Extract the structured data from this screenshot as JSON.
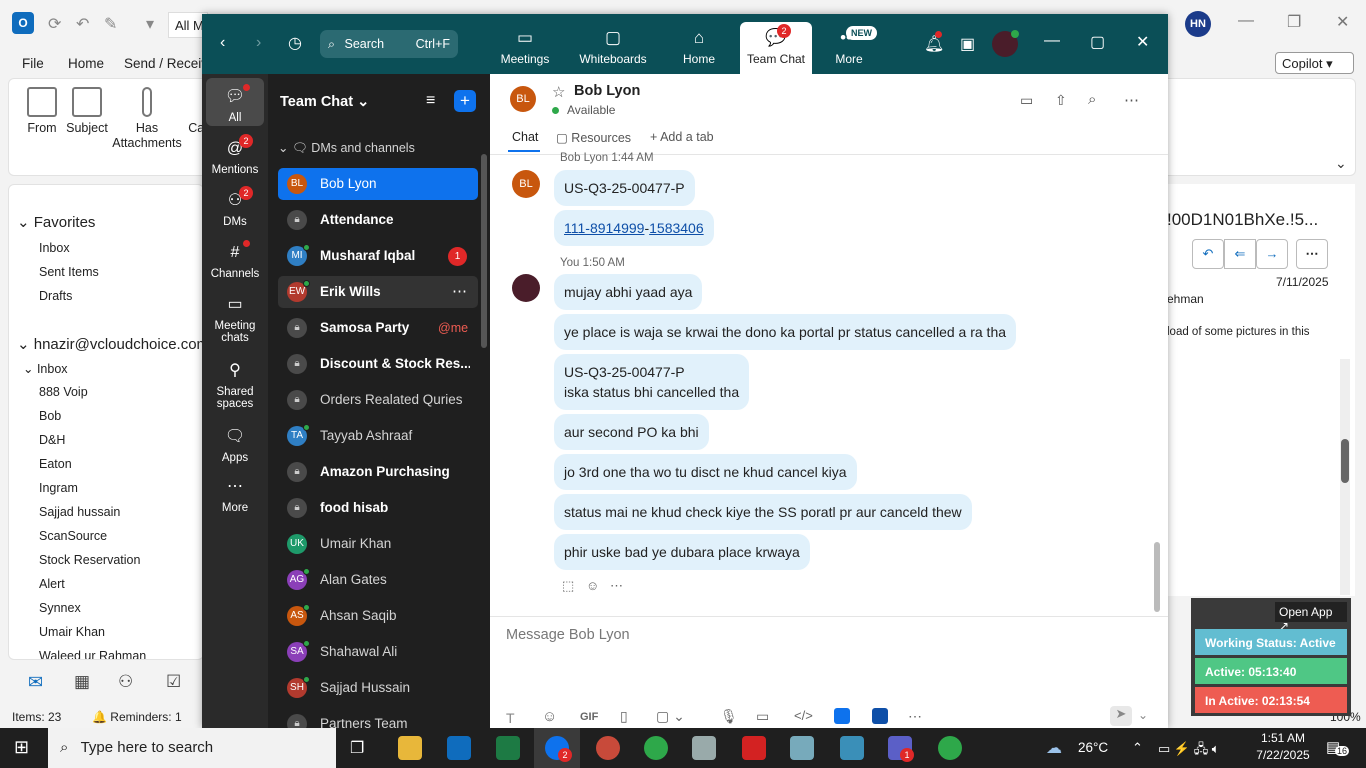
{
  "outlook": {
    "all_mail": "All M",
    "avatar": "HN",
    "menu": [
      "File",
      "Home",
      "Send / Receive"
    ],
    "ribbon": [
      "From",
      "Subject",
      "Has Attachments",
      "Cat"
    ],
    "copilot": "Copilot",
    "favorites_header": "Favorites",
    "favorites": [
      "Inbox",
      "Sent Items",
      "Drafts"
    ],
    "account": "hnazir@vcloudchoice.com",
    "inbox_header": "Inbox",
    "folders": [
      "888 Voip",
      "Bob",
      "D&H",
      "Eaton",
      "Ingram",
      "Sajjad hussain",
      "ScanSource",
      "Stock Reservation",
      "Alert",
      "Synnex",
      "Umair Khan",
      "Waleed ur Rahman"
    ],
    "status_items": "Items: 23",
    "status_reminders": "Reminders: 1",
    "zoom_level": "100%",
    "reading_subject": "!00D1N01BhXe.!5...",
    "reading_date": "7/11/2025",
    "reading_from": "ehman",
    "reading_snippet": "load of some pictures in this"
  },
  "zoom": {
    "search_label": "Search",
    "search_shortcut": "Ctrl+F",
    "tabs": [
      {
        "label": "Meetings"
      },
      {
        "label": "Whiteboards"
      },
      {
        "label": "Home"
      },
      {
        "label": "Team Chat",
        "badge": "2"
      },
      {
        "label": "More",
        "badge": "NEW"
      }
    ],
    "rail": [
      {
        "label": "All"
      },
      {
        "label": "Mentions",
        "badge": "2"
      },
      {
        "label": "DMs",
        "badge": "2"
      },
      {
        "label": "Channels"
      },
      {
        "label": "Meeting chats"
      },
      {
        "label": "Shared spaces"
      },
      {
        "label": "Apps"
      },
      {
        "label": "More"
      }
    ],
    "list_title": "Team Chat",
    "section": "DMs and channels",
    "conversations": [
      {
        "name": "Bob Lyon",
        "initials": "BL",
        "color": "#c8570e",
        "selected": true
      },
      {
        "name": "Attendance",
        "lock": true,
        "bold": true
      },
      {
        "name": "Musharaf Iqbal",
        "initials": "MI",
        "color": "#2f7fc4",
        "bold": true,
        "badge": "1",
        "online": true
      },
      {
        "name": "Erik Wills",
        "initials": "EW",
        "color": "#b23a2e",
        "bold": true,
        "online": true,
        "hover": true
      },
      {
        "name": "Samosa Party",
        "lock": true,
        "bold": true,
        "mention": "@me"
      },
      {
        "name": "Discount & Stock Res...",
        "lock": true,
        "bold": true
      },
      {
        "name": "Orders Realated Quries",
        "lock": true
      },
      {
        "name": "Tayyab Ashraaf",
        "initials": "TA",
        "color": "#2f7fc4",
        "online": true
      },
      {
        "name": "Amazon Purchasing",
        "lock": true,
        "bold": true
      },
      {
        "name": "food hisab",
        "lock": true,
        "bold": true
      },
      {
        "name": "Umair Khan",
        "initials": "UK",
        "color": "#1e9a6a"
      },
      {
        "name": "Alan Gates",
        "initials": "AG",
        "color": "#8b3fb8",
        "online": true
      },
      {
        "name": "Ahsan Saqib",
        "initials": "AS",
        "color": "#c8570e",
        "online": true
      },
      {
        "name": "Shahawal Ali",
        "initials": "SA",
        "color": "#8b3fb8",
        "online": true
      },
      {
        "name": "Sajjad Hussain",
        "initials": "SH",
        "color": "#b23a2e",
        "online": true
      },
      {
        "name": "Partners Team",
        "lock": true
      }
    ],
    "contact_name": "Bob Lyon",
    "contact_initials": "BL",
    "contact_status": "Available",
    "chat_tabs": [
      "Chat",
      "Resources",
      "Add a tab"
    ],
    "msg_header_1": "Bob Lyon 1:44 AM",
    "msg_header_2_name": "You",
    "msg_header_2_time": "1:50 AM",
    "phone_parts": [
      "111-8914999",
      "-",
      "1583406"
    ],
    "messages_bob": [
      "US-Q3-25-00477-P"
    ],
    "messages_you": [
      "mujay abhi yaad aya",
      "ye place is waja se krwai the dono ka portal pr status cancelled a ra tha",
      "US-Q3-25-00477-P",
      "iska status bhi cancelled tha",
      "aur second PO ka bhi",
      "jo 3rd one tha wo tu disct ne khud cancel kiya",
      "status mai ne khud check kiye the SS poratl pr aur canceld thew",
      "phir uske bad ye dubara place krwaya"
    ],
    "composer_placeholder": "Message Bob Lyon",
    "composer_gif": "GIF"
  },
  "widget": {
    "open_app": "Open App",
    "working_status": "Working Status: Active",
    "active": "Active: 05:13:40",
    "inactive": "In Active: 02:13:54"
  },
  "taskbar": {
    "search_placeholder": "Type here to search",
    "temperature": "26°C",
    "time": "1:51 AM",
    "date": "7/22/2025",
    "notif_count": "16",
    "zoom_badge": "2",
    "teams_badge": "1"
  },
  "colors": {
    "zoom_header": "#0b4f57",
    "zoom_accent": "#0e72ed",
    "bubble": "#e1f1fb",
    "working": "#62bdd1",
    "active": "#4fc785",
    "inactive": "#ee5c52"
  }
}
